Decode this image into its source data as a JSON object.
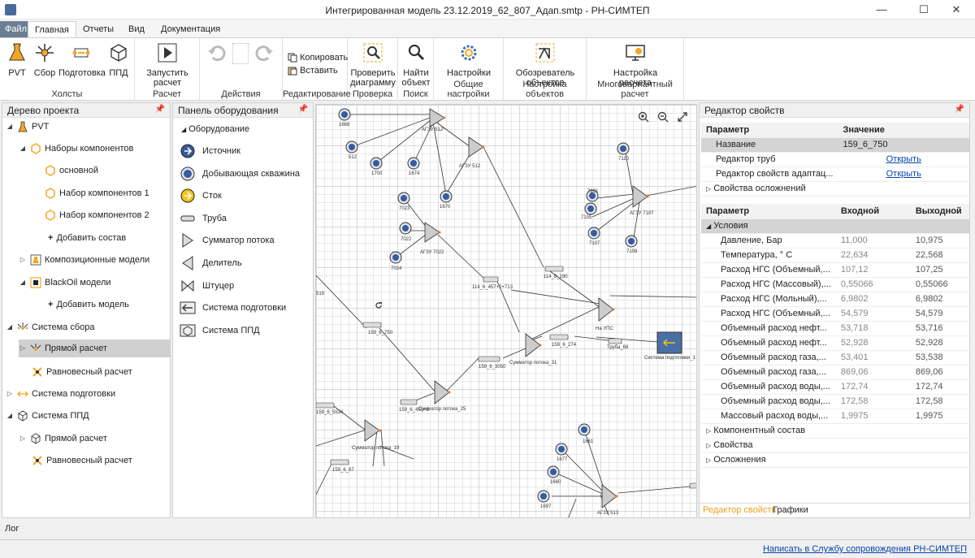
{
  "window": {
    "title": "Интегрированная модель 23.12.2019_62_807_Адап.smtp - РН-СИМТЕП",
    "minimize": "—",
    "maximize": "☐",
    "close": "✕"
  },
  "menu": {
    "file": "Файл",
    "tabs": [
      "Главная",
      "Отчеты",
      "Вид",
      "Документация"
    ]
  },
  "ribbon": {
    "groups": [
      {
        "label": "Холсты",
        "buttons": [
          "PVT",
          "Сбор",
          "Подготовка",
          "ППД"
        ]
      },
      {
        "label": "Расчет",
        "buttons": [
          "Запустить расчет"
        ]
      },
      {
        "label": "Действия",
        "buttons": []
      },
      {
        "label": "Редактирование",
        "buttons": [
          "Копировать",
          "Вставить"
        ]
      },
      {
        "label": "Проверка",
        "buttons": [
          "Проверить диаграмму"
        ]
      },
      {
        "label": "Поиск",
        "buttons": [
          "Найти объект"
        ]
      },
      {
        "label": "Общие настройки",
        "buttons": [
          "Настройки"
        ]
      },
      {
        "label": "Настройка объектов",
        "buttons": [
          "Обозреватель объектов"
        ]
      },
      {
        "label": "Многовариантный расчет",
        "buttons": [
          "Настройка расчета"
        ]
      }
    ]
  },
  "tree": {
    "title": "Дерево проекта",
    "nodes": [
      {
        "label": "PVT"
      },
      {
        "label": "Наборы компонентов"
      },
      {
        "label": "основной"
      },
      {
        "label": "Набор компонентов 1"
      },
      {
        "label": "Набор компонентов 2"
      },
      {
        "label": "Добавить состав"
      },
      {
        "label": "Композиционные модели"
      },
      {
        "label": "BlackOil модели"
      },
      {
        "label": "Добавить модель"
      },
      {
        "label": "Система сбора"
      },
      {
        "label": "Прямой расчет"
      },
      {
        "label": "Равновесный расчет"
      },
      {
        "label": "Система подготовки"
      },
      {
        "label": "Система ППД"
      },
      {
        "label": "Прямой расчет"
      },
      {
        "label": "Равновесный расчет"
      }
    ]
  },
  "equipment": {
    "title": "Панель оборудования",
    "group": "Оборудование",
    "items": [
      "Источник",
      "Добывающая скважина",
      "Сток",
      "Труба",
      "Сумматор потока",
      "Делитель",
      "Штуцер",
      "Система подготовки",
      "Система ППД"
    ]
  },
  "diagram": {
    "labels": [
      "1668",
      "512",
      "1700",
      "1674",
      "АГЗУ 512*",
      "АГЗУ 512",
      "1670",
      "7023",
      "7022",
      "7024",
      "АГЗУ 7022",
      "114_6_457+2+713",
      "114_6_190",
      "159_6_750",
      "159_6_274",
      "159_6_3050",
      "Сумматор потока_31",
      "На УПС",
      "Труба_68",
      "Система подготовки_1",
      "159_6_5534",
      "159_6_450+1",
      "Сумматор потока_25",
      "Сумматор потока_19",
      "159_6_87",
      "7110",
      "7101",
      "7105",
      "7107",
      "7108",
      "АГЗУ 7107",
      "1661",
      "1677",
      "1660",
      "1697",
      "АГЗУ 513",
      "519"
    ]
  },
  "props": {
    "title": "Редактор свойств",
    "header1": {
      "param": "Параметр",
      "value": "Значение"
    },
    "rows1": [
      {
        "name": "Название",
        "value": "159_6_750"
      },
      {
        "name": "Редактор труб",
        "value": "Открыть"
      },
      {
        "name": "Редактор свойств адаптац...",
        "value": "Открыть"
      },
      {
        "name": "Свойства осложнений",
        "value": ""
      }
    ],
    "header2": {
      "param": "Параметр",
      "in": "Входной",
      "out": "Выходной"
    },
    "section": "Условия",
    "rows2": [
      {
        "name": "Давление, Бар",
        "in": "11,000",
        "out": "10,975"
      },
      {
        "name": "Температура, ° С",
        "in": "22,634",
        "out": "22,568"
      },
      {
        "name": "Расход НГС (Объемный,...",
        "in": "107,12",
        "out": "107,25"
      },
      {
        "name": "Расход НГС (Массовый),...",
        "in": "0,55066",
        "out": "0,55066"
      },
      {
        "name": "Расход НГС (Мольный),...",
        "in": "6,9802",
        "out": "6,9802"
      },
      {
        "name": "Расход НГС (Объемный,...",
        "in": "54,579",
        "out": "54,579"
      },
      {
        "name": "Объемный расход нефт...",
        "in": "53,718",
        "out": "53,716"
      },
      {
        "name": "Объемный расход нефт...",
        "in": "52,928",
        "out": "52,928"
      },
      {
        "name": "Объемный расход газа,...",
        "in": "53,401",
        "out": "53,538"
      },
      {
        "name": "Объемный расход газа,...",
        "in": "869,06",
        "out": "869,06"
      },
      {
        "name": "Объемный расход воды,...",
        "in": "172,74",
        "out": "172,74"
      },
      {
        "name": "Объемный расход воды,...",
        "in": "172,58",
        "out": "172,58"
      },
      {
        "name": "Массовый расход воды,...",
        "in": "1,9975",
        "out": "1,9975"
      }
    ],
    "footer_rows": [
      "Компонентный состав",
      "Свойства",
      "Осложнения"
    ],
    "tabs": [
      "Редактор свойств",
      "Графики"
    ]
  },
  "log": "Лог",
  "status": {
    "link": "Написать в Службу сопровождения РН-СИМТЕП"
  }
}
